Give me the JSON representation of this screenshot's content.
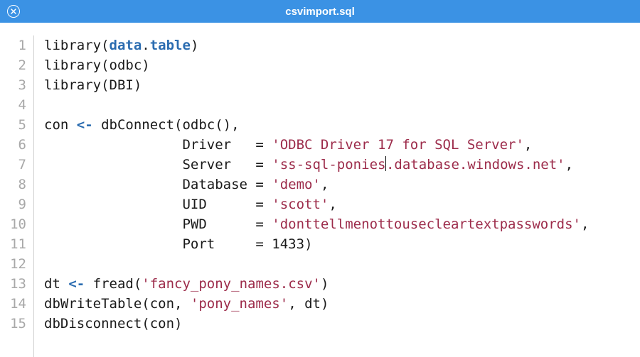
{
  "titlebar": {
    "filename": "csvimport.sql"
  },
  "gutter": {
    "numbers": [
      "1",
      "2",
      "3",
      "4",
      "5",
      "6",
      "7",
      "8",
      "9",
      "10",
      "11",
      "12",
      "13",
      "14",
      "15"
    ]
  },
  "code": {
    "lines": [
      {
        "segments": [
          {
            "t": "library(",
            "c": ""
          },
          {
            "t": "data",
            "c": "kw"
          },
          {
            "t": ".",
            "c": ""
          },
          {
            "t": "table",
            "c": "kw"
          },
          {
            "t": ")",
            "c": ""
          }
        ]
      },
      {
        "segments": [
          {
            "t": "library(odbc)",
            "c": ""
          }
        ]
      },
      {
        "segments": [
          {
            "t": "library(DBI)",
            "c": ""
          }
        ]
      },
      {
        "segments": [
          {
            "t": "",
            "c": ""
          }
        ]
      },
      {
        "segments": [
          {
            "t": "con ",
            "c": ""
          },
          {
            "t": "<-",
            "c": "op"
          },
          {
            "t": " dbConnect(odbc(),",
            "c": ""
          }
        ]
      },
      {
        "segments": [
          {
            "t": "                 Driver   = ",
            "c": ""
          },
          {
            "t": "'ODBC Driver 17 for SQL Server'",
            "c": "str"
          },
          {
            "t": ",",
            "c": ""
          }
        ]
      },
      {
        "segments": [
          {
            "t": "                 Server   = ",
            "c": ""
          },
          {
            "t": "'ss-sql-ponies",
            "c": "str"
          },
          {
            "t": "",
            "c": "cursor"
          },
          {
            "t": ".database.windows.net'",
            "c": "str"
          },
          {
            "t": ",",
            "c": ""
          }
        ]
      },
      {
        "segments": [
          {
            "t": "                 Database = ",
            "c": ""
          },
          {
            "t": "'demo'",
            "c": "str"
          },
          {
            "t": ",",
            "c": ""
          }
        ]
      },
      {
        "segments": [
          {
            "t": "                 UID      = ",
            "c": ""
          },
          {
            "t": "'scott'",
            "c": "str"
          },
          {
            "t": ",",
            "c": ""
          }
        ]
      },
      {
        "segments": [
          {
            "t": "                 PWD      = ",
            "c": ""
          },
          {
            "t": "'donttellmenottousecleartextpasswords'",
            "c": "str"
          },
          {
            "t": ",",
            "c": ""
          }
        ]
      },
      {
        "segments": [
          {
            "t": "                 Port     = ",
            "c": ""
          },
          {
            "t": "1433",
            "c": "num"
          },
          {
            "t": ")",
            "c": ""
          }
        ]
      },
      {
        "segments": [
          {
            "t": "",
            "c": ""
          }
        ]
      },
      {
        "segments": [
          {
            "t": "dt ",
            "c": ""
          },
          {
            "t": "<-",
            "c": "op"
          },
          {
            "t": " fread(",
            "c": ""
          },
          {
            "t": "'fancy_pony_names.csv'",
            "c": "str"
          },
          {
            "t": ")",
            "c": ""
          }
        ]
      },
      {
        "segments": [
          {
            "t": "dbWriteTable(con, ",
            "c": ""
          },
          {
            "t": "'pony_names'",
            "c": "str"
          },
          {
            "t": ", dt)",
            "c": ""
          }
        ]
      },
      {
        "segments": [
          {
            "t": "dbDisconnect(con)",
            "c": ""
          }
        ]
      }
    ]
  }
}
